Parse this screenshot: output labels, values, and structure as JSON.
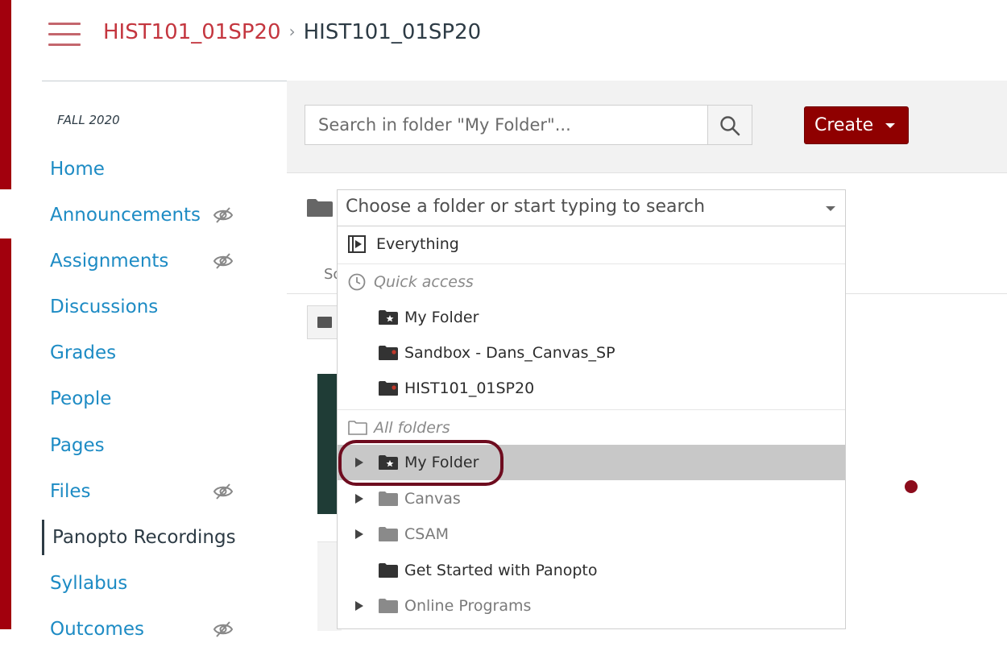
{
  "header": {
    "course_link": "HIST101_01SP20",
    "current_page": "HIST101_01SP20",
    "separator": "›"
  },
  "nav": {
    "term": "FALL 2020",
    "items": [
      {
        "label": "Home",
        "hidden_icon": false
      },
      {
        "label": "Announcements",
        "hidden_icon": true
      },
      {
        "label": "Assignments",
        "hidden_icon": true
      },
      {
        "label": "Discussions",
        "hidden_icon": false
      },
      {
        "label": "Grades",
        "hidden_icon": false
      },
      {
        "label": "People",
        "hidden_icon": false
      },
      {
        "label": "Pages",
        "hidden_icon": false
      },
      {
        "label": "Files",
        "hidden_icon": true
      },
      {
        "label": "Panopto Recordings",
        "hidden_icon": false,
        "active": true
      },
      {
        "label": "Syllabus",
        "hidden_icon": false
      },
      {
        "label": "Outcomes",
        "hidden_icon": true
      }
    ]
  },
  "toolbar": {
    "search_placeholder": "Search in folder \"My Folder\"...",
    "create_label": "Create"
  },
  "content": {
    "sort_hint": "So"
  },
  "folder_chooser": {
    "placeholder": "Choose a folder or start typing to search",
    "everything": "Everything",
    "quick_access_heading": "Quick access",
    "quick_access": [
      "My Folder",
      "Sandbox - Dans_Canvas_SP",
      "HIST101_01SP20"
    ],
    "all_folders_heading": "All folders",
    "all_folders": [
      "My Folder",
      "Canvas",
      "CSAM",
      "Get Started with Panopto",
      "Online Programs"
    ],
    "selected": "My Folder"
  },
  "colors": {
    "brand_red": "#a2000d",
    "link_blue": "#1d8bc4",
    "create_button": "#8f0000",
    "highlight_ring": "#6e0c1f"
  }
}
